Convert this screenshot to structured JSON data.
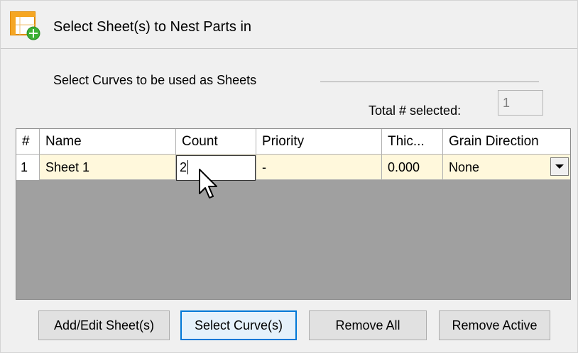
{
  "dialog": {
    "title": "Select Sheet(s) to Nest Parts in",
    "icon": "sheet-add-icon"
  },
  "selection": {
    "group_label": "Select Curves to be used as Sheets",
    "total_label": "Total # selected:",
    "total_value": "1"
  },
  "table": {
    "columns": [
      "#",
      "Name",
      "Count",
      "Priority",
      "Thic...",
      "Grain Direction"
    ],
    "rows": [
      {
        "num": "1",
        "name": "Sheet 1",
        "count": "2",
        "priority": "-",
        "thickness": "0.000",
        "grain_direction": "None"
      }
    ]
  },
  "buttons": {
    "add_edit": "Add/Edit Sheet(s)",
    "select_curves": "Select Curve(s)",
    "remove_all": "Remove All",
    "remove_active": "Remove Active"
  },
  "colors": {
    "row_highlight": "#fff8dc",
    "empty_grid": "#a0a0a0",
    "focus_border": "#0078d7"
  }
}
